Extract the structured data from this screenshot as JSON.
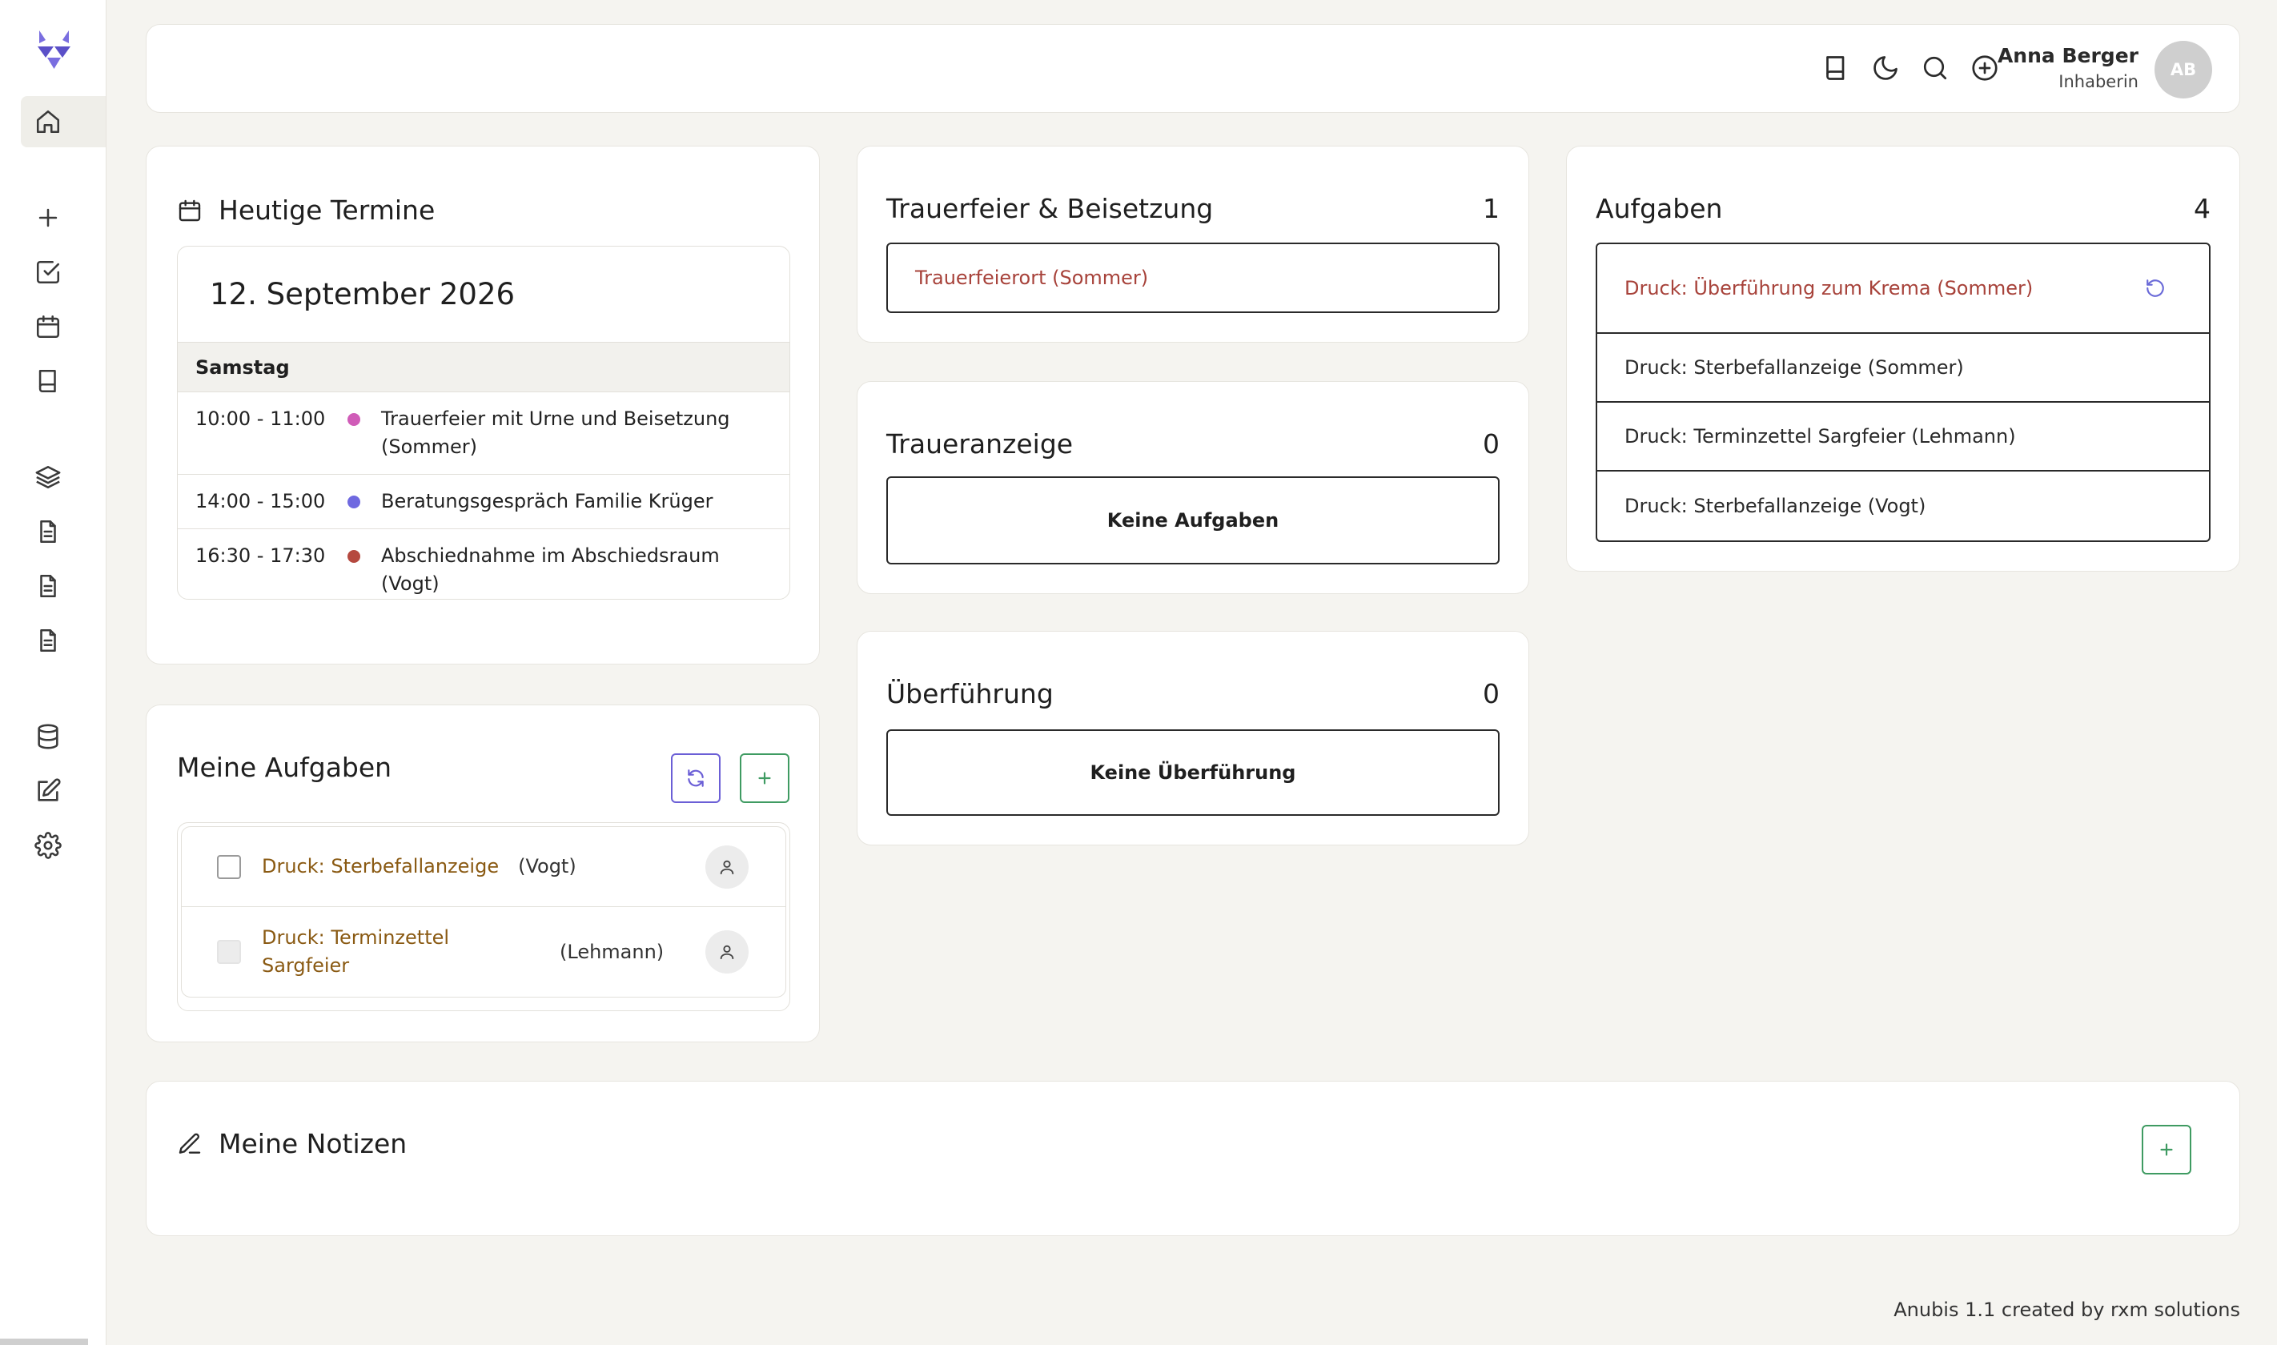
{
  "colors": {
    "accent": "#6b5fd6",
    "green": "#3f9b62",
    "red_text": "#a7423a",
    "task_link": "#8a5a13",
    "dot_pink": "#d05cb8",
    "dot_blue": "#6f69e0",
    "dot_red": "#b5493f"
  },
  "sidebar": {
    "logo_icon": "anubis-logo",
    "items": [
      {
        "name": "home",
        "icon": "home-icon",
        "active": true
      },
      {
        "name": "add",
        "icon": "plus-icon"
      },
      {
        "name": "tasks",
        "icon": "check-square-icon"
      },
      {
        "name": "calendar",
        "icon": "calendar-icon"
      },
      {
        "name": "book",
        "icon": "book-icon"
      },
      {
        "name": "layers",
        "icon": "layers-icon"
      },
      {
        "name": "document-1",
        "icon": "document-icon"
      },
      {
        "name": "document-2",
        "icon": "document-icon"
      },
      {
        "name": "document-3",
        "icon": "document-icon"
      },
      {
        "name": "database",
        "icon": "database-icon"
      },
      {
        "name": "edit",
        "icon": "edit-icon"
      },
      {
        "name": "settings",
        "icon": "gear-icon"
      }
    ]
  },
  "topbar": {
    "icons": [
      "book-icon",
      "moon-icon",
      "search-icon",
      "plus-circle-icon"
    ],
    "user_name": "Anna Berger",
    "user_role": "Inhaberin",
    "avatar_initials": "AB"
  },
  "termine": {
    "title": "Heutige Termine",
    "date": "12. September 2026",
    "day": "Samstag",
    "events": [
      {
        "time": "10:00 - 11:00",
        "text": "Trauerfeier mit Urne und Beisetzung (Sommer)",
        "color": "#d05cb8"
      },
      {
        "time": "14:00 - 15:00",
        "text": "Beratungsgespräch Familie Krüger",
        "color": "#6f69e0"
      },
      {
        "time": "16:30 - 17:30",
        "text": "Abschiednahme im Abschiedsraum (Vogt)",
        "color": "#b5493f"
      }
    ]
  },
  "meine_aufgaben": {
    "title": "Meine Aufgaben",
    "tasks": [
      {
        "label": "Druck: Sterbefallanzeige",
        "case": "(Vogt)"
      },
      {
        "label": "Druck: Terminzettel Sargfeier",
        "case": "(Lehmann)"
      }
    ]
  },
  "trauerfeier": {
    "title": "Trauerfeier & Beisetzung",
    "count": "1",
    "item": "Trauerfeierort (Sommer)"
  },
  "traueranzeige": {
    "title": "Traueranzeige",
    "count": "0",
    "empty": "Keine Aufgaben"
  },
  "ueberfuehrung": {
    "title": "Überführung",
    "count": "0",
    "empty": "Keine Überführung"
  },
  "aufgaben": {
    "title": "Aufgaben",
    "count": "4",
    "items": [
      "Druck: Überführung zum Krema (Sommer)",
      "Druck: Sterbefallanzeige (Sommer)",
      "Druck: Terminzettel Sargfeier (Lehmann)",
      "Druck: Sterbefallanzeige (Vogt)"
    ]
  },
  "notizen": {
    "title": "Meine Notizen"
  },
  "footer": "Anubis 1.1 created by rxm solutions"
}
